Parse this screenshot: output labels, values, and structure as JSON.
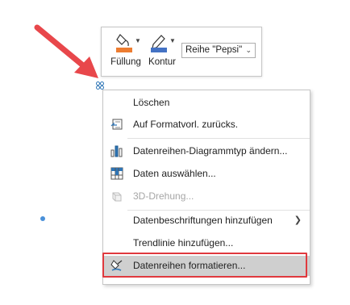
{
  "toolbar": {
    "fill_label": "Füllung",
    "outline_label": "Kontur",
    "series_value": "Reihe \"Pepsi\"",
    "fill_color": "#ed7d31",
    "outline_color": "#4472c4"
  },
  "menu": {
    "items": [
      {
        "label": "Löschen",
        "icon": "none",
        "enabled": true
      },
      {
        "label": "Auf Formatvorl. zurücks.",
        "icon": "reset-style-icon",
        "enabled": true
      },
      {
        "label": "Datenreihen-Diagrammtyp ändern...",
        "icon": "bar-chart-icon",
        "enabled": true
      },
      {
        "label": "Daten auswählen...",
        "icon": "select-data-icon",
        "enabled": true
      },
      {
        "label": "3D-Drehung...",
        "icon": "3d-rotation-icon",
        "enabled": false
      },
      {
        "label": "Datenbeschriftungen hinzufügen",
        "icon": "none",
        "enabled": true,
        "submenu": true
      },
      {
        "label": "Trendlinie hinzufügen...",
        "icon": "none",
        "enabled": true
      },
      {
        "label": "Datenreihen formatieren...",
        "icon": "format-series-icon",
        "enabled": true,
        "highlighted": true
      }
    ]
  },
  "colors": {
    "accent_red": "#e0393e",
    "highlight": "#cfcfcf",
    "chart_icon_blue": "#2e75b6"
  }
}
